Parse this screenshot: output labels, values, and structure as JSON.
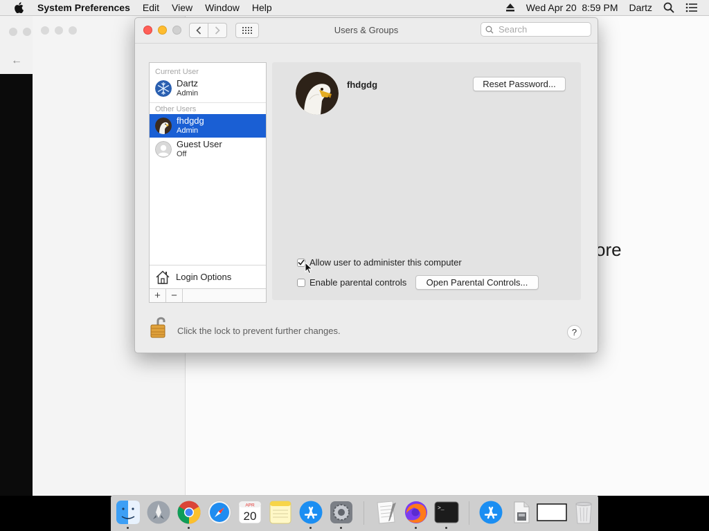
{
  "menubar": {
    "app_name": "System Preferences",
    "items": [
      "Edit",
      "View",
      "Window",
      "Help"
    ],
    "datetime": "Wed Apr 20  8:59 PM",
    "user": "Dartz"
  },
  "background_window": {
    "partial_text": "ore"
  },
  "window": {
    "title": "Users & Groups",
    "search_placeholder": "Search"
  },
  "users": {
    "current_label": "Current User",
    "other_label": "Other Users",
    "current": {
      "name": "Dartz",
      "role": "Admin"
    },
    "others": [
      {
        "name": "fhdgdg",
        "role": "Admin",
        "selected": true
      },
      {
        "name": "Guest User",
        "role": "Off",
        "selected": false
      }
    ],
    "login_options": "Login Options",
    "add_label": "+",
    "remove_label": "−"
  },
  "detail": {
    "username": "fhdgdg",
    "reset_password": "Reset Password...",
    "allow_admin_label": "Allow user to administer this computer",
    "allow_admin_checked": true,
    "parental_label": "Enable parental controls",
    "parental_checked": false,
    "open_parental": "Open Parental Controls..."
  },
  "footer": {
    "lock_text": "Click the lock to prevent further changes.",
    "help": "?"
  },
  "dock": {
    "calendar_month": "APR",
    "calendar_day": "20",
    "terminal_prompt": ">_"
  }
}
